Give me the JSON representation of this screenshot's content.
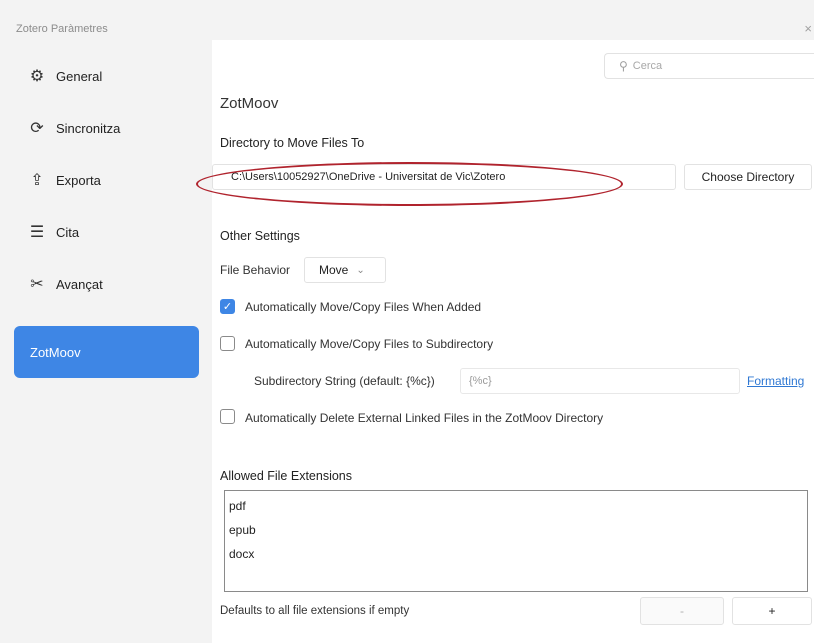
{
  "window": {
    "title": "Zotero Paràmetres",
    "close": "×"
  },
  "sidebar": {
    "items": [
      {
        "label": "General",
        "icon": "gear-icon",
        "glyph": "⚙"
      },
      {
        "label": "Sincronitza",
        "icon": "sync-icon",
        "glyph": "⟳"
      },
      {
        "label": "Exporta",
        "icon": "export-icon",
        "glyph": "⇪"
      },
      {
        "label": "Cita",
        "icon": "cite-icon",
        "glyph": "☰"
      },
      {
        "label": "Avançat",
        "icon": "tools-icon",
        "glyph": "✂"
      },
      {
        "label": "ZotMoov",
        "icon": "",
        "glyph": ""
      }
    ],
    "active_color": "#3e86e5"
  },
  "search": {
    "placeholder": "Cerca",
    "glyph": "⚲"
  },
  "pane": {
    "title": "ZotMoov",
    "directory": {
      "heading": "Directory to Move Files To",
      "value": "C:\\Users\\10052927\\OneDrive - Universitat de Vic\\Zotero",
      "button": "Choose Directory"
    },
    "other": {
      "heading": "Other Settings",
      "file_behavior_label": "File Behavior",
      "file_behavior_value": "Move",
      "chevron": "⌄",
      "check_auto_move": "Automatically Move/Copy Files When Added",
      "check_subdir": "Automatically Move/Copy Files to Subdirectory",
      "subdir_label": "Subdirectory String (default: {%c})",
      "subdir_value": "{%c}",
      "formatting_link": "Formatting",
      "check_delete": "Automatically Delete External Linked Files in the ZotMoov Directory",
      "checkmark": "✓"
    },
    "extensions": {
      "heading": "Allowed File Extensions",
      "items": [
        "pdf",
        "epub",
        "docx"
      ],
      "footer": "Defaults to all file extensions if empty",
      "remove_label": "-",
      "add_label": "+"
    }
  },
  "colors": {
    "accent": "#3e86e5",
    "annotation": "#b0232d",
    "link": "#2f78d3"
  }
}
